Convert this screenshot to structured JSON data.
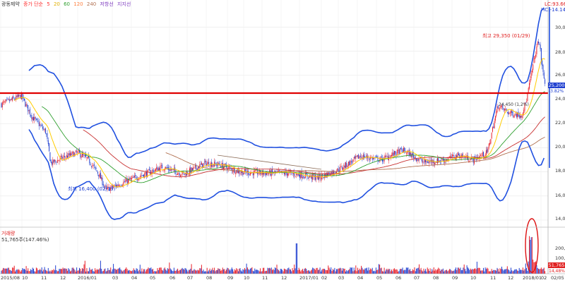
{
  "stock_name": "광동제약",
  "legend": {
    "ma_title": "종가 단순",
    "periods": [
      {
        "label": "5",
        "color": "#ff3030"
      },
      {
        "label": "20",
        "color": "#ffcc00"
      },
      {
        "label": "60",
        "color": "#30a030"
      },
      {
        "label": "120",
        "color": "#ff8040"
      },
      {
        "label": "240",
        "color": "#b07050"
      }
    ],
    "resistance": "저항선",
    "support": "지지선"
  },
  "top_right": {
    "lc": "LC:93.66",
    "hc": "HC:-14.14"
  },
  "annotations": {
    "high": "최고 29,350 (01/29)",
    "low": "최저 16,400 (02/19)",
    "mid": "24,450 (1,2%)"
  },
  "price_badge": {
    "value": "25,200",
    "change": "-3.82%"
  },
  "y_ticks": [
    "30,000",
    "28,000",
    "26,000",
    "24,000",
    "22,000",
    "20,000",
    "18,000",
    "16,000",
    "14,000"
  ],
  "volume": {
    "label": "거래량",
    "value": "51,765주(147.46%)",
    "y_ticks": [
      "200,000",
      "100,000"
    ],
    "badge_value": "51,765",
    "badge_change": "14,48%"
  },
  "x_ticks": [
    "2015/08",
    "10",
    "11",
    "12",
    "2016/01",
    "03",
    "04",
    "05",
    "06",
    "07",
    "08",
    "09",
    "10",
    "11",
    "12",
    "2017/01",
    "02",
    "03",
    "04",
    "05",
    "06",
    "07",
    "08",
    "09",
    "10",
    "11",
    "12",
    "2018/01",
    "02",
    "02/05"
  ],
  "colors": {
    "up": "#e8202a",
    "down": "#2040d0",
    "bollinger": "#2050e0",
    "resistance": "#e00000",
    "highlight": "#dd1010"
  }
}
